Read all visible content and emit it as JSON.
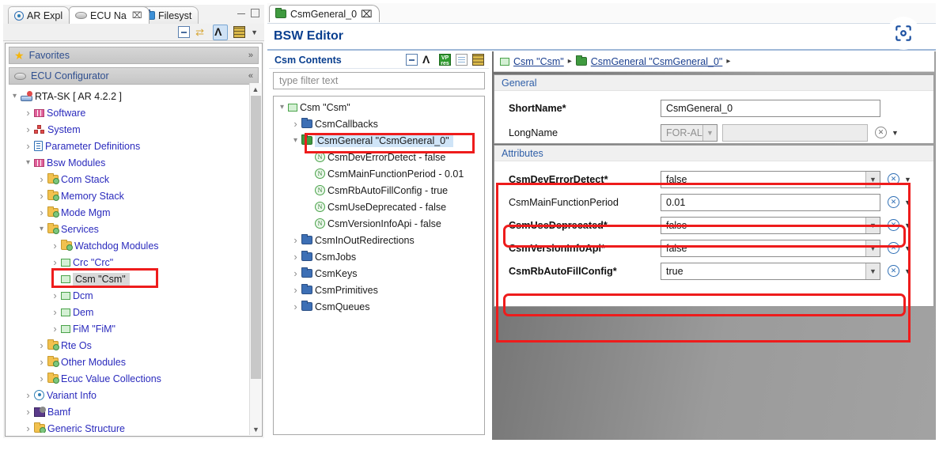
{
  "left_view": {
    "tabs": [
      {
        "label": "AR Expl",
        "icon": "ar-explorer-icon",
        "active": false
      },
      {
        "label": "ECU Na",
        "icon": "ecu-navigator-icon",
        "active": true,
        "close": "⌧"
      },
      {
        "label": "Filesyst",
        "icon": "filesystem-icon",
        "active": false
      }
    ],
    "window_buttons": [
      "minimize",
      "maximize"
    ],
    "toolbar_icons": [
      "collapse-all-icon",
      "link-with-editor-icon",
      "fork-variant-icon",
      "table-view-icon",
      "view-menu-icon"
    ],
    "sections": [
      {
        "label": "Favorites",
        "icon": "star-icon",
        "chevron": "»"
      },
      {
        "label": "ECU Configurator",
        "icon": "ecu-icon",
        "chevron": "«"
      }
    ],
    "tree": [
      {
        "label": "RTA-SK [ AR 4.2.2 ]",
        "indent": 0,
        "arrow": "expanded",
        "icon": "rta-sk-icon",
        "color": "dark"
      },
      {
        "label": "Software",
        "indent": 1,
        "arrow": "collapsed",
        "icon": "software-icon",
        "color": "blue"
      },
      {
        "label": "System",
        "indent": 1,
        "arrow": "collapsed",
        "icon": "system-icon",
        "color": "blue"
      },
      {
        "label": "Parameter Definitions",
        "indent": 1,
        "arrow": "collapsed",
        "icon": "parameter-definitions-icon",
        "color": "blue"
      },
      {
        "label": "Bsw Modules",
        "indent": 1,
        "arrow": "expanded",
        "icon": "bsw-modules-icon",
        "color": "blue"
      },
      {
        "label": "Com Stack",
        "indent": 2,
        "arrow": "collapsed",
        "icon": "folder-yellow-icon",
        "color": "blue"
      },
      {
        "label": "Memory Stack",
        "indent": 2,
        "arrow": "collapsed",
        "icon": "folder-yellow-icon",
        "color": "blue"
      },
      {
        "label": "Mode Mgm",
        "indent": 2,
        "arrow": "collapsed",
        "icon": "folder-yellow-icon",
        "color": "blue"
      },
      {
        "label": "Services",
        "indent": 2,
        "arrow": "expanded",
        "icon": "folder-yellow-icon",
        "color": "blue"
      },
      {
        "label": "Watchdog Modules",
        "indent": 3,
        "arrow": "collapsed",
        "icon": "folder-yellow-icon",
        "color": "blue"
      },
      {
        "label": "Crc \"Crc\"",
        "indent": 3,
        "arrow": "collapsed",
        "icon": "module-icon",
        "color": "blue"
      },
      {
        "label": "Csm \"Csm\"",
        "indent": 3,
        "arrow": "none",
        "icon": "module-icon",
        "color": "dark",
        "selected": true
      },
      {
        "label": "Dcm",
        "indent": 3,
        "arrow": "collapsed",
        "icon": "module-icon",
        "color": "blue"
      },
      {
        "label": "Dem",
        "indent": 3,
        "arrow": "collapsed",
        "icon": "module-icon",
        "color": "blue"
      },
      {
        "label": "FiM \"FiM\"",
        "indent": 3,
        "arrow": "collapsed",
        "icon": "module-icon",
        "color": "blue"
      },
      {
        "label": "Rte Os",
        "indent": 2,
        "arrow": "collapsed",
        "icon": "folder-yellow-icon",
        "color": "blue"
      },
      {
        "label": "Other Modules",
        "indent": 2,
        "arrow": "collapsed",
        "icon": "folder-yellow-icon",
        "color": "blue"
      },
      {
        "label": "Ecuc Value Collections",
        "indent": 2,
        "arrow": "collapsed",
        "icon": "folder-yellow-icon",
        "color": "blue"
      },
      {
        "label": "Variant Info",
        "indent": 1,
        "arrow": "collapsed",
        "icon": "variant-info-icon",
        "color": "blue"
      },
      {
        "label": "Bamf",
        "indent": 1,
        "arrow": "collapsed",
        "icon": "bamf-icon",
        "color": "blue"
      },
      {
        "label": "Generic Structure",
        "indent": 1,
        "arrow": "collapsed",
        "icon": "folder-yellow-icon",
        "color": "blue"
      }
    ]
  },
  "editor": {
    "tab": {
      "label": "CsmGeneral_0",
      "icon": "folder-green-icon",
      "close": "⌧"
    },
    "title": "BSW Editor",
    "contents": {
      "header": "Csm Contents",
      "toolbar_icons": [
        "collapse-all-icon",
        "fork-variant-icon",
        "variant-policy-icon",
        "show-description-icon",
        "table-view-icon"
      ],
      "filter_placeholder": "type filter text",
      "tree": [
        {
          "label": "Csm \"Csm\"",
          "indent": 0,
          "arrow": "expanded",
          "icon": "module-icon"
        },
        {
          "label": "CsmCallbacks",
          "indent": 1,
          "arrow": "collapsed",
          "icon": "folder-blue-icon"
        },
        {
          "label": "CsmGeneral \"CsmGeneral_0\"",
          "indent": 1,
          "arrow": "expanded",
          "icon": "folder-green-icon",
          "selected": true
        },
        {
          "label": "CsmDevErrorDetect - false",
          "indent": 2,
          "arrow": "none",
          "icon": "parameter-icon"
        },
        {
          "label": "CsmMainFunctionPeriod - 0.01",
          "indent": 2,
          "arrow": "none",
          "icon": "parameter-icon"
        },
        {
          "label": "CsmRbAutoFillConfig - true",
          "indent": 2,
          "arrow": "none",
          "icon": "parameter-icon"
        },
        {
          "label": "CsmUseDeprecated - false",
          "indent": 2,
          "arrow": "none",
          "icon": "parameter-icon"
        },
        {
          "label": "CsmVersionInfoApi - false",
          "indent": 2,
          "arrow": "none",
          "icon": "parameter-icon"
        },
        {
          "label": "CsmInOutRedirections",
          "indent": 1,
          "arrow": "collapsed",
          "icon": "folder-blue-icon"
        },
        {
          "label": "CsmJobs",
          "indent": 1,
          "arrow": "collapsed",
          "icon": "folder-blue-icon"
        },
        {
          "label": "CsmKeys",
          "indent": 1,
          "arrow": "collapsed",
          "icon": "folder-blue-icon"
        },
        {
          "label": "CsmPrimitives",
          "indent": 1,
          "arrow": "collapsed",
          "icon": "folder-blue-icon"
        },
        {
          "label": "CsmQueues",
          "indent": 1,
          "arrow": "collapsed",
          "icon": "folder-blue-icon"
        }
      ]
    },
    "breadcrumb": [
      {
        "label": "Csm \"Csm\"",
        "icon": "module-icon"
      },
      {
        "label": "CsmGeneral \"CsmGeneral_0\"",
        "icon": "folder-green-icon"
      }
    ],
    "breadcrumb_separator": "▸",
    "general": {
      "title": "General",
      "rows": [
        {
          "label": "ShortName*",
          "required": true,
          "type": "text",
          "value": "CsmGeneral_0"
        },
        {
          "label": "LongName",
          "required": false,
          "type": "locale",
          "locale": "FOR-ALL",
          "value": ""
        }
      ]
    },
    "attributes": {
      "title": "Attributes",
      "rows": [
        {
          "label": "CsmDevErrorDetect*",
          "required": true,
          "type": "combo",
          "value": "false",
          "highlighted": false
        },
        {
          "label": "CsmMainFunctionPeriod",
          "required": false,
          "type": "text",
          "value": "0.01",
          "highlighted": true
        },
        {
          "label": "CsmUseDeprecated*",
          "required": true,
          "type": "combo",
          "value": "false",
          "highlighted": false
        },
        {
          "label": "CsmVersionInfoApi*",
          "required": true,
          "type": "combo",
          "value": "false",
          "highlighted": false
        },
        {
          "label": "CsmRbAutoFillConfig*",
          "required": true,
          "type": "combo",
          "value": "true",
          "highlighted": true
        }
      ]
    }
  },
  "overlay": {
    "camera_icon": "screenshot-focus-icon",
    "annotation_color": "#ee1c1c"
  }
}
